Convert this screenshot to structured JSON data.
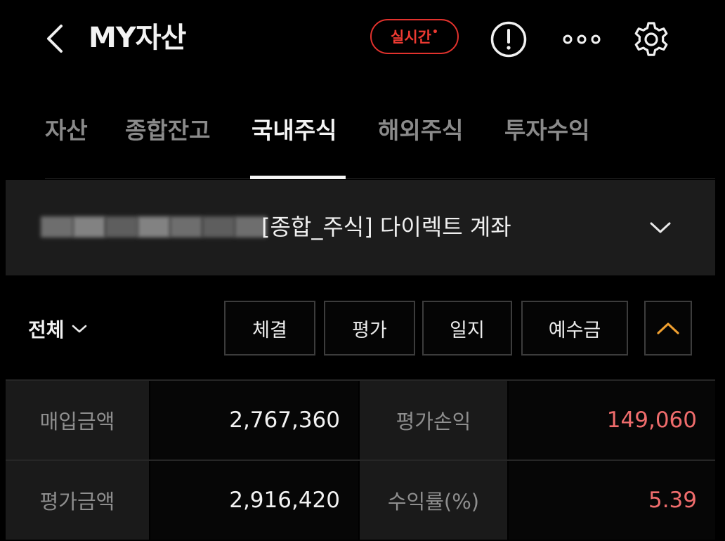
{
  "header": {
    "title": "MY자산",
    "realtime_label": "실시간",
    "realtime_mark": "•"
  },
  "tabs": [
    {
      "label": "자산",
      "active": false
    },
    {
      "label": "종합잔고",
      "active": false
    },
    {
      "label": "국내주식",
      "active": true
    },
    {
      "label": "해외주식",
      "active": false
    },
    {
      "label": "투자수익",
      "active": false
    }
  ],
  "account": {
    "name": "[종합_주식] 다이렉트 계좌",
    "number_masked": true
  },
  "filter": {
    "selected": "전체",
    "buttons": [
      "체결",
      "평가",
      "일지",
      "예수금"
    ]
  },
  "summary": {
    "rows": [
      {
        "left_label": "매입금액",
        "left_value": "2,767,360",
        "right_label": "평가손익",
        "right_value": "149,060"
      },
      {
        "left_label": "평가금액",
        "left_value": "2,916,420",
        "right_label": "수익률(%)",
        "right_value": "5.39"
      }
    ]
  },
  "colors": {
    "background": "#000000",
    "accent_red": "#e2322d",
    "profit": "#ef6c6c",
    "collapse_arrow": "#f0a030",
    "panel": "#1c1c1c"
  },
  "icons": [
    "back-arrow-icon",
    "alert-icon",
    "more-icon",
    "settings-icon",
    "chevron-down-icon",
    "chevron-up-icon"
  ]
}
